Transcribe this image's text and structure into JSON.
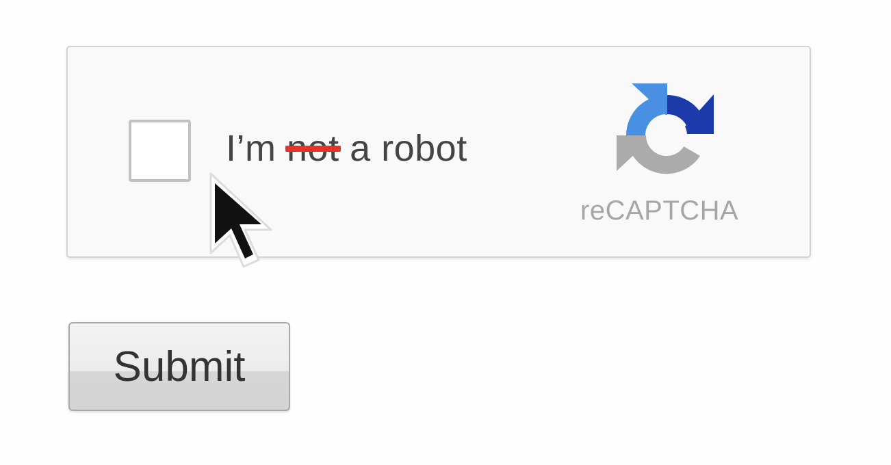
{
  "captcha": {
    "label_before": "I’m ",
    "label_struck": "not",
    "label_after": " a robot",
    "strike_color": "#e53329",
    "brand": "reCAPTCHA",
    "checkbox_checked": false,
    "logo_icon": "recaptcha-logo-icon"
  },
  "form": {
    "submit_label": "Submit"
  },
  "cursor": {
    "icon": "mouse-pointer-icon"
  },
  "colors": {
    "logo_blue_light": "#4a90e2",
    "logo_blue_dark": "#1c3aa9",
    "logo_gray": "#ababab"
  }
}
